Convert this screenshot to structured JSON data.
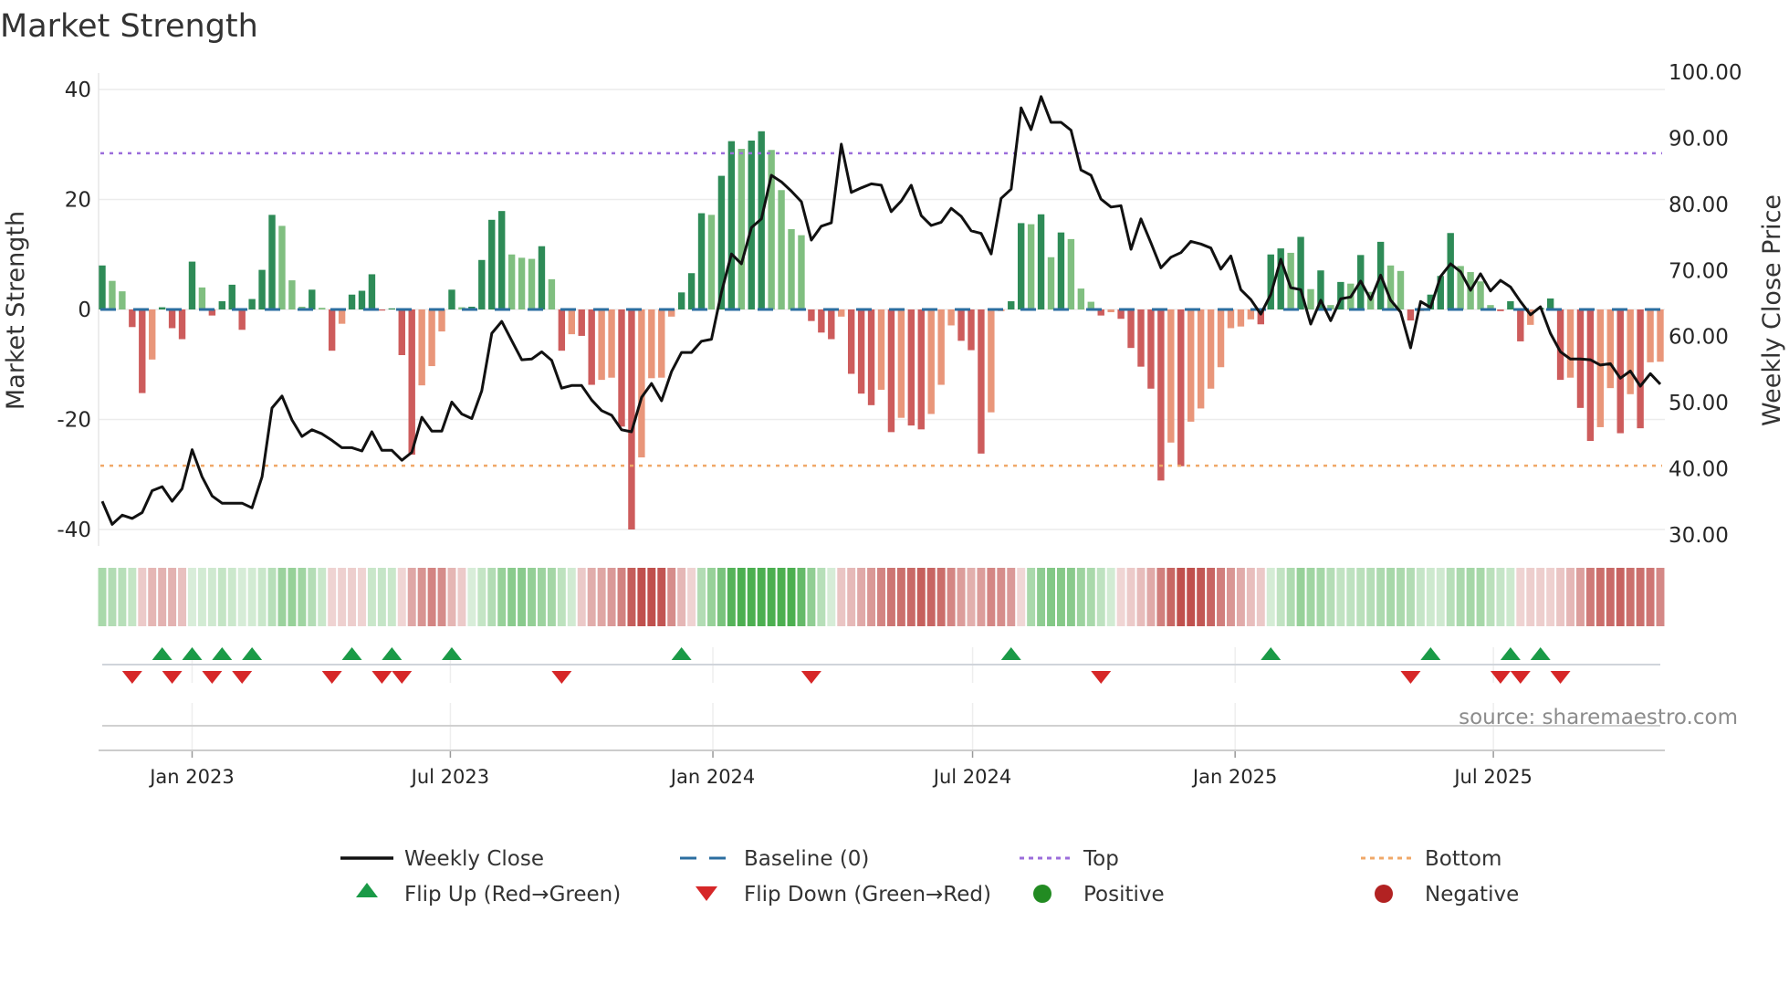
{
  "chart_data": {
    "type": "bar",
    "title": "Market Strength",
    "ylabel": "Market Strength",
    "y2label": "Weekly Close Price",
    "ylim": [
      -40,
      40
    ],
    "y2lim": [
      30,
      100
    ],
    "yticks": [
      "-40",
      "-20",
      "0",
      "20",
      "40"
    ],
    "y2ticks": [
      "30.00",
      "40.00",
      "50.00",
      "60.00",
      "70.00",
      "80.00",
      "90.00",
      "100.00"
    ],
    "start_date": "2022-10-30",
    "frequency": "weekly",
    "xticks": [
      {
        "label": "Jan 2023",
        "date": "2023-01-01"
      },
      {
        "label": "Jul 2023",
        "date": "2023-07-01"
      },
      {
        "label": "Jan 2024",
        "date": "2024-01-01"
      },
      {
        "label": "Jul 2024",
        "date": "2024-07-01"
      },
      {
        "label": "Jan 2025",
        "date": "2025-01-01"
      },
      {
        "label": "Jul 2025",
        "date": "2025-07-01"
      }
    ],
    "top_level": 28.4,
    "bottom_level": -28.4,
    "baseline": 0,
    "strength": [
      8,
      5.2,
      3.3,
      -3.2,
      -15.2,
      -9.1,
      0.4,
      -3.4,
      -5.4,
      8.7,
      4.0,
      -1.1,
      1.5,
      4.5,
      -3.7,
      1.9,
      7.2,
      17.2,
      15.2,
      5.3,
      0.5,
      3.6,
      0.3,
      -7.5,
      -2.6,
      2.7,
      3.4,
      6.4,
      -0.2,
      0.2,
      -8.3,
      -26.4,
      -13.8,
      -10.3,
      -4.0,
      3.6,
      0.4,
      0.5,
      9.0,
      16.3,
      17.9,
      10.0,
      9.4,
      9.2,
      11.5,
      5.5,
      -7.5,
      -4.5,
      -4.8,
      -13.7,
      -12.8,
      -12.4,
      -21.3,
      -40,
      -26.9,
      -12.5,
      -12.4,
      -1.3,
      3.1,
      6.6,
      17.5,
      17.2,
      24.3,
      30.6,
      29.2,
      30.7,
      32.4,
      29.0,
      21.7,
      14.6,
      13.5,
      -2.1,
      -4.2,
      -5.4,
      -1.3,
      -11.7,
      -15.3,
      -17.4,
      -14.6,
      -22.3,
      -19.7,
      -21.1,
      -21.8,
      -19.0,
      -13.7,
      -2.9,
      -5.7,
      -7.4,
      -26.2,
      -18.7,
      -0.3,
      1.5,
      15.7,
      15.5,
      17.3,
      9.5,
      14.0,
      12.8,
      3.8,
      1.4,
      -1.1,
      -0.5,
      -1.7,
      -7.0,
      -10.4,
      -14.4,
      -31.1,
      -24.2,
      -28.5,
      -20.4,
      -18.0,
      -14.4,
      -10.5,
      -3.4,
      -3.1,
      -1.8,
      -2.7,
      10.0,
      11.1,
      10.3,
      13.2,
      3.7,
      7.1,
      0.8,
      5.0,
      4.7,
      9.9,
      3.2,
      12.3,
      8.0,
      7.0,
      -2.0,
      -0.3,
      2.7,
      6.1,
      13.9,
      7.9,
      6.8,
      5.1,
      0.8,
      -0.3,
      1.5,
      -5.8,
      -2.8,
      0.3,
      2.0,
      -12.8,
      -12.4,
      -17.9,
      -23.9,
      -21.4,
      -14.3,
      -22.5,
      -15.4,
      -21.6,
      -9.6,
      -9.5
    ],
    "weekly_close": [
      35.1,
      31.6,
      33.0,
      32.5,
      33.4,
      36.7,
      37.3,
      35.1,
      37.0,
      42.9,
      38.8,
      35.9,
      34.8,
      34.8,
      34.8,
      34.1,
      38.8,
      49.2,
      51.0,
      47.4,
      44.9,
      45.9,
      45.3,
      44.3,
      43.2,
      43.2,
      42.7,
      45.6,
      42.8,
      42.8,
      41.3,
      42.5,
      47.8,
      45.7,
      45.7,
      50.1,
      48.3,
      47.6,
      51.8,
      60.5,
      62.3,
      59.4,
      56.5,
      56.6,
      57.7,
      56.4,
      52.2,
      52.6,
      52.6,
      50.4,
      48.8,
      48.1,
      45.9,
      45.6,
      50.8,
      52.9,
      50.3,
      54.7,
      57.6,
      57.6,
      59.3,
      59.6,
      66.7,
      72.5,
      71.0,
      76.5,
      77.8,
      84.4,
      83.4,
      82.0,
      80.4,
      74.6,
      76.7,
      77.2,
      89.1,
      81.8,
      82.5,
      83.1,
      82.9,
      78.9,
      80.5,
      82.9,
      78.3,
      76.8,
      77.3,
      79.4,
      78.2,
      76.0,
      75.6,
      72.5,
      80.9,
      82.3,
      94.6,
      91.3,
      96.3,
      92.4,
      92.4,
      91.2,
      85.2,
      84.4,
      80.8,
      79.6,
      79.8,
      73.2,
      77.8,
      74.2,
      70.4,
      72.0,
      72.7,
      74.4,
      74.0,
      73.4,
      70.2,
      72.2,
      67.1,
      65.6,
      63.4,
      66.4,
      71.7,
      67.4,
      67.1,
      61.9,
      65.5,
      62.4,
      65.7,
      66.0,
      68.4,
      65.6,
      69.3,
      65.5,
      63.7,
      58.3,
      65.3,
      64.4,
      69.1,
      71.0,
      69.8,
      67.0,
      69.5,
      66.9,
      68.5,
      67.5,
      65.3,
      63.3,
      64.5,
      60.5,
      57.7,
      56.6,
      56.6,
      56.5,
      55.7,
      55.9,
      53.7,
      54.8,
      52.5,
      54.4,
      52.8
    ],
    "flip_up_weeks": [
      6,
      9,
      12,
      15,
      25,
      29,
      35,
      58,
      91,
      117,
      133,
      141,
      144
    ],
    "flip_down_weeks": [
      3,
      7,
      11,
      14,
      23,
      28,
      30,
      46,
      71,
      100,
      131,
      140,
      142,
      146
    ],
    "legend": {
      "placement": "bottom",
      "items": [
        {
          "key": "close",
          "label": "Weekly Close"
        },
        {
          "key": "baseline",
          "label": "Baseline (0)"
        },
        {
          "key": "top",
          "label": "Top"
        },
        {
          "key": "bottom",
          "label": "Bottom"
        },
        {
          "key": "flip_up",
          "label": "Flip Up (Red→Green)"
        },
        {
          "key": "flip_down",
          "label": "Flip Down (Green→Red)"
        },
        {
          "key": "positive",
          "label": "Positive"
        },
        {
          "key": "negative",
          "label": "Negative"
        }
      ]
    },
    "source": "source: sharemaestro.com"
  },
  "colors": {
    "pos_rising": "#2e8b57",
    "pos_falling": "#80bf80",
    "neg_falling": "#cd5c5c",
    "neg_rising": "#e9967a",
    "close": "#111111",
    "baseline": "#2b6ea0",
    "top": "#9b6ddb",
    "bottom": "#f0a868",
    "flip_up": "#1a9a47",
    "flip_down": "#d62728",
    "positive": "#228b22",
    "negative": "#b22222",
    "strip_pos": "#4caf50",
    "strip_neg": "#c0504d"
  }
}
